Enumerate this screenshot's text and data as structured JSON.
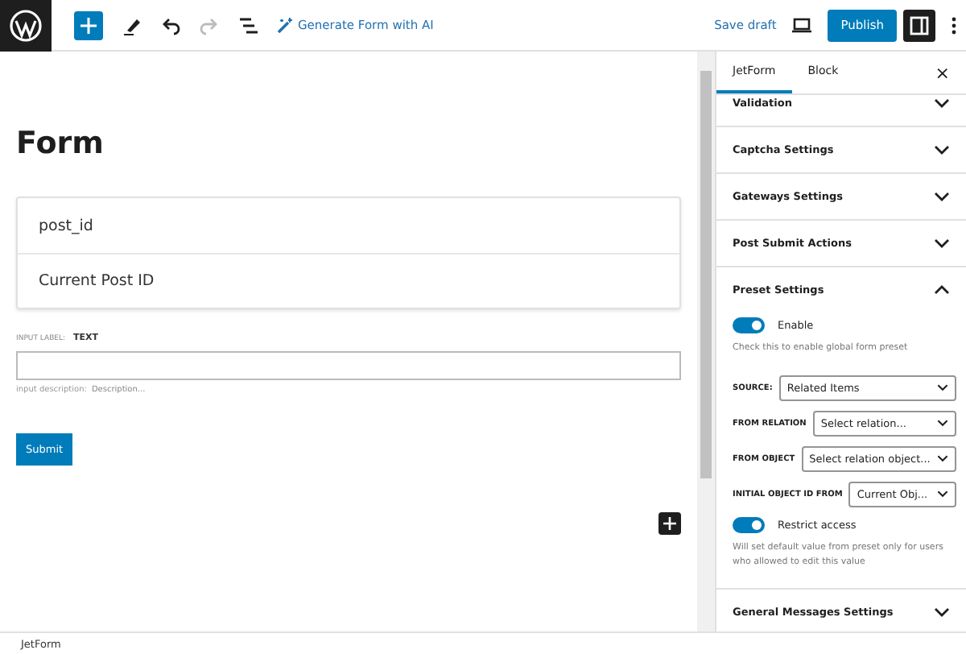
{
  "toolbar": {
    "ai_link": "Generate Form with AI",
    "save_draft": "Save draft",
    "publish": "Publish",
    "sidebar_toggle": {
      "on": true
    }
  },
  "canvas": {
    "title": "Form",
    "card": [
      "post_id",
      "Current Post ID"
    ],
    "input_label_caption": "INPUT LABEL:",
    "input_label": "TEXT",
    "description_caption": "input description:",
    "description_placeholder": "Description...",
    "submit": "Submit"
  },
  "sidebar": {
    "tabs": [
      {
        "label": "JetForm",
        "selected": true
      },
      {
        "label": "Block",
        "selected": false
      }
    ],
    "close": "×",
    "sections": [
      {
        "title": "Validation",
        "expanded": false
      },
      {
        "title": "Captcha Settings",
        "expanded": false
      },
      {
        "title": "Gateways Settings",
        "expanded": false
      },
      {
        "title": "Post Submit Actions",
        "expanded": false
      },
      {
        "title": "Preset Settings",
        "expanded": true,
        "controls": [
          {
            "kind": "toggle",
            "label": "Enable",
            "on": true,
            "help": "Check this to enable global form preset"
          },
          {
            "kind": "select",
            "label": "SOURCE:",
            "value": "Related Items"
          },
          {
            "kind": "select",
            "label": "FROM RELATION",
            "value": "Select relation..."
          },
          {
            "kind": "select",
            "label": "FROM OBJECT",
            "value": "Select relation object..."
          },
          {
            "kind": "select",
            "label": "INITIAL OBJECT ID FROM",
            "value": "Current Obj..."
          },
          {
            "kind": "toggle",
            "label": "Restrict access",
            "on": true,
            "help": "Will set default value from preset only for users who allowed to edit this value"
          }
        ]
      },
      {
        "title": "General Messages Settings",
        "expanded": false
      }
    ]
  },
  "status_bar": {
    "breadcrumb": "JetForm"
  }
}
